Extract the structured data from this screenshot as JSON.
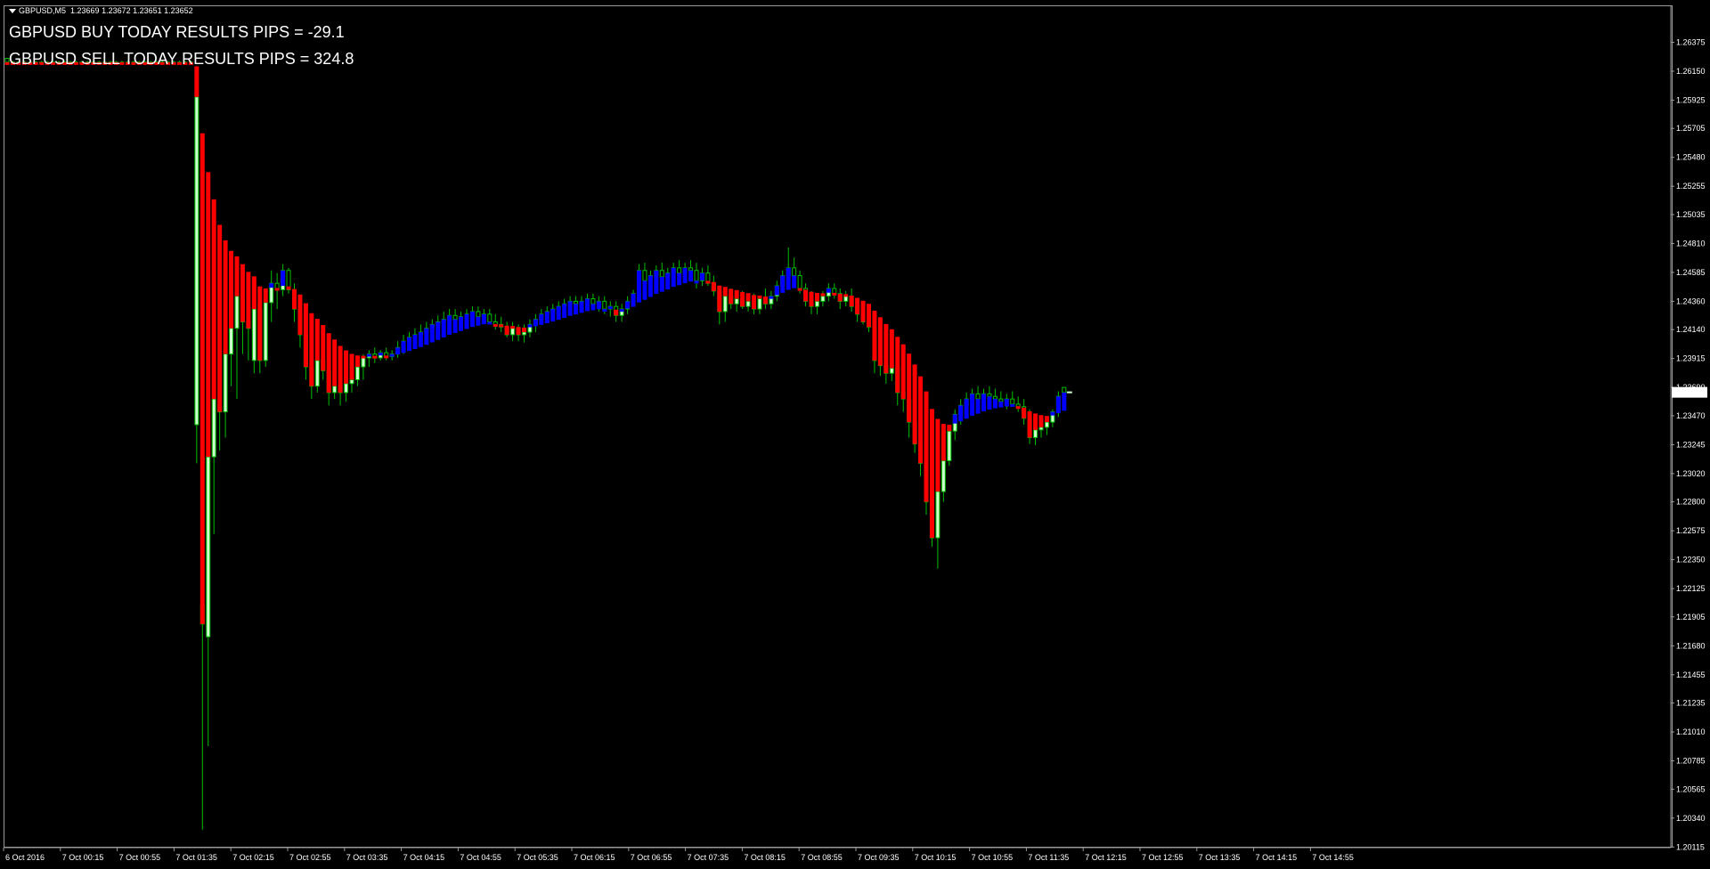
{
  "header": {
    "symbol": "GBPUSD,M5",
    "ohlc": "1.23669 1.23672 1.23651 1.23652"
  },
  "results": {
    "buy": "GBPUSD BUY TODAY RESULTS PIPS = -29.1",
    "sell": "GBPUSD SELL TODAY RESULTS PIPS = 324.8"
  },
  "current_price_label": "1.23652",
  "colors": {
    "background": "#000000",
    "frame": "#9a9a9a",
    "bull_candle": "#ccffcc",
    "bear_candle": "#000000",
    "wick": "#00c000",
    "bear_band": "#ff0000",
    "bull_band": "#0000ff"
  },
  "chart_data": {
    "type": "candlestick",
    "grid": false,
    "y_tick_labels": [
      "1.26375",
      "1.26150",
      "1.25925",
      "1.25705",
      "1.25480",
      "1.25255",
      "1.25035",
      "1.24810",
      "1.24585",
      "1.24360",
      "1.24140",
      "1.23915",
      "1.23690",
      "1.23470",
      "1.23245",
      "1.23020",
      "1.22800",
      "1.22575",
      "1.22350",
      "1.22125",
      "1.21905",
      "1.21680",
      "1.21455",
      "1.21235",
      "1.21010",
      "1.20785",
      "1.20565",
      "1.20340",
      "1.20115"
    ],
    "x_tick_labels": [
      "6 Oct 2016",
      "7 Oct 00:15",
      "7 Oct 00:55",
      "7 Oct 01:35",
      "7 Oct 02:15",
      "7 Oct 02:55",
      "7 Oct 03:35",
      "7 Oct 04:15",
      "7 Oct 04:55",
      "7 Oct 05:35",
      "7 Oct 06:15",
      "7 Oct 06:55",
      "7 Oct 07:35",
      "7 Oct 08:15",
      "7 Oct 08:55",
      "7 Oct 09:35",
      "7 Oct 10:15",
      "7 Oct 10:55",
      "7 Oct 11:35",
      "7 Oct 12:15",
      "7 Oct 12:55",
      "7 Oct 13:35",
      "7 Oct 14:15",
      "7 Oct 14:55"
    ],
    "ylim": [
      1.2011,
      1.2651
    ],
    "candle_interval_minutes": 5,
    "current_price": 1.23652,
    "candles": [
      [
        1.2625,
        1.2625,
        1.2621,
        1.2622
      ],
      [
        1.2622,
        1.2623,
        1.2621,
        1.2622
      ],
      [
        1.2622,
        1.2623,
        1.2621,
        1.2622
      ],
      [
        1.2622,
        1.2623,
        1.2621,
        1.2622
      ],
      [
        1.2622,
        1.2623,
        1.2621,
        1.2622
      ],
      [
        1.2622,
        1.2623,
        1.2621,
        1.2622
      ],
      [
        1.2622,
        1.2623,
        1.2621,
        1.2622
      ],
      [
        1.2622,
        1.2623,
        1.2621,
        1.2622
      ],
      [
        1.2622,
        1.2623,
        1.2621,
        1.2622
      ],
      [
        1.2622,
        1.2623,
        1.2621,
        1.2622
      ],
      [
        1.2622,
        1.2623,
        1.2621,
        1.2622
      ],
      [
        1.2622,
        1.2623,
        1.2621,
        1.2622
      ],
      [
        1.2622,
        1.2623,
        1.2621,
        1.2622
      ],
      [
        1.2622,
        1.2623,
        1.2621,
        1.2622
      ],
      [
        1.2622,
        1.2623,
        1.2621,
        1.2622
      ],
      [
        1.2622,
        1.2623,
        1.2621,
        1.2622
      ],
      [
        1.2622,
        1.2623,
        1.2621,
        1.2622
      ],
      [
        1.2622,
        1.2623,
        1.2621,
        1.2622
      ],
      [
        1.2622,
        1.2623,
        1.2621,
        1.2622
      ],
      [
        1.2622,
        1.2623,
        1.2621,
        1.2622
      ],
      [
        1.2622,
        1.2623,
        1.2621,
        1.2622
      ],
      [
        1.2622,
        1.2623,
        1.2621,
        1.2622
      ],
      [
        1.2622,
        1.2623,
        1.2621,
        1.2622
      ],
      [
        1.2622,
        1.2623,
        1.2621,
        1.2622
      ],
      [
        1.2622,
        1.2623,
        1.2621,
        1.2622
      ],
      [
        1.2622,
        1.2623,
        1.2621,
        1.2622
      ],
      [
        1.2622,
        1.2623,
        1.2621,
        1.2622
      ],
      [
        1.2622,
        1.2623,
        1.2621,
        1.2622
      ],
      [
        1.2622,
        1.2623,
        1.2621,
        1.2622
      ],
      [
        1.2622,
        1.2623,
        1.2621,
        1.2622
      ],
      [
        1.2622,
        1.2623,
        1.2621,
        1.2622
      ],
      [
        1.2622,
        1.2623,
        1.2621,
        1.2622
      ],
      [
        1.2622,
        1.2623,
        1.2621,
        1.2622
      ],
      [
        1.234,
        1.2605,
        1.231,
        1.2595
      ],
      [
        1.22,
        1.226,
        1.2025,
        1.2185
      ],
      [
        1.2175,
        1.2325,
        1.209,
        1.2315
      ],
      [
        1.2315,
        1.2365,
        1.2255,
        1.236
      ],
      [
        1.2355,
        1.2375,
        1.232,
        1.235
      ],
      [
        1.235,
        1.2405,
        1.233,
        1.2395
      ],
      [
        1.2395,
        1.2425,
        1.237,
        1.2415
      ],
      [
        1.2415,
        1.2445,
        1.236,
        1.244
      ],
      [
        1.244,
        1.245,
        1.2395,
        1.242
      ],
      [
        1.242,
        1.2435,
        1.239,
        1.2415
      ],
      [
        1.239,
        1.244,
        1.238,
        1.243
      ],
      [
        1.243,
        1.2445,
        1.238,
        1.239
      ],
      [
        1.239,
        1.244,
        1.2385,
        1.2435
      ],
      [
        1.2435,
        1.246,
        1.242,
        1.245
      ],
      [
        1.245,
        1.2458,
        1.243,
        1.2445
      ],
      [
        1.2445,
        1.2465,
        1.244,
        1.246
      ],
      [
        1.246,
        1.2462,
        1.2442,
        1.2445
      ],
      [
        1.2445,
        1.245,
        1.242,
        1.243
      ],
      [
        1.243,
        1.244,
        1.24,
        1.241
      ],
      [
        1.241,
        1.242,
        1.2375,
        1.2385
      ],
      [
        1.2385,
        1.2395,
        1.236,
        1.237
      ],
      [
        1.237,
        1.2395,
        1.2365,
        1.239
      ],
      [
        1.239,
        1.2395,
        1.2375,
        1.2382
      ],
      [
        1.2382,
        1.2392,
        1.2355,
        1.2365
      ],
      [
        1.2365,
        1.2385,
        1.236,
        1.237
      ],
      [
        1.237,
        1.2375,
        1.2355,
        1.2365
      ],
      [
        1.2365,
        1.2378,
        1.2358,
        1.2372
      ],
      [
        1.2372,
        1.2382,
        1.2365,
        1.2375
      ],
      [
        1.2375,
        1.239,
        1.237,
        1.2385
      ],
      [
        1.2385,
        1.2395,
        1.2375,
        1.2392
      ],
      [
        1.2392,
        1.2398,
        1.2385,
        1.2395
      ],
      [
        1.2395,
        1.24,
        1.2388,
        1.2392
      ],
      [
        1.2392,
        1.2398,
        1.239,
        1.2396
      ],
      [
        1.2396,
        1.24,
        1.239,
        1.2393
      ],
      [
        1.2393,
        1.2398,
        1.239,
        1.2395
      ],
      [
        1.2395,
        1.2405,
        1.2392,
        1.24
      ],
      [
        1.24,
        1.241,
        1.2395,
        1.2405
      ],
      [
        1.2405,
        1.2412,
        1.24,
        1.2408
      ],
      [
        1.2408,
        1.2415,
        1.2402,
        1.241
      ],
      [
        1.241,
        1.2418,
        1.2405,
        1.2412
      ],
      [
        1.2412,
        1.242,
        1.2408,
        1.2415
      ],
      [
        1.2415,
        1.2422,
        1.241,
        1.2418
      ],
      [
        1.2418,
        1.2425,
        1.2412,
        1.242
      ],
      [
        1.242,
        1.2428,
        1.2415,
        1.2422
      ],
      [
        1.2422,
        1.243,
        1.2418,
        1.2425
      ],
      [
        1.2425,
        1.243,
        1.2418,
        1.2422
      ],
      [
        1.2422,
        1.2428,
        1.2418,
        1.2424
      ],
      [
        1.2424,
        1.243,
        1.242,
        1.2426
      ],
      [
        1.2426,
        1.2432,
        1.2422,
        1.2428
      ],
      [
        1.2428,
        1.2432,
        1.2422,
        1.2424
      ],
      [
        1.2424,
        1.243,
        1.242,
        1.2426
      ],
      [
        1.2426,
        1.243,
        1.2418,
        1.242
      ],
      [
        1.242,
        1.2426,
        1.2414,
        1.2418
      ],
      [
        1.2418,
        1.2424,
        1.2412,
        1.2416
      ],
      [
        1.2416,
        1.242,
        1.2408,
        1.241
      ],
      [
        1.241,
        1.242,
        1.2405,
        1.2415
      ],
      [
        1.2415,
        1.2418,
        1.2405,
        1.241
      ],
      [
        1.241,
        1.2418,
        1.2404,
        1.2412
      ],
      [
        1.2412,
        1.2422,
        1.2408,
        1.2418
      ],
      [
        1.2418,
        1.2426,
        1.2412,
        1.2422
      ],
      [
        1.2422,
        1.243,
        1.2418,
        1.2426
      ],
      [
        1.2426,
        1.2432,
        1.242,
        1.2428
      ],
      [
        1.2428,
        1.2434,
        1.2422,
        1.243
      ],
      [
        1.243,
        1.2436,
        1.2424,
        1.2432
      ],
      [
        1.2432,
        1.2438,
        1.2426,
        1.2434
      ],
      [
        1.2434,
        1.244,
        1.2428,
        1.2436
      ],
      [
        1.2436,
        1.244,
        1.243,
        1.2434
      ],
      [
        1.2434,
        1.244,
        1.2428,
        1.2436
      ],
      [
        1.2436,
        1.2442,
        1.243,
        1.2438
      ],
      [
        1.2438,
        1.2442,
        1.243,
        1.2434
      ],
      [
        1.2434,
        1.244,
        1.2428,
        1.2436
      ],
      [
        1.2436,
        1.244,
        1.2426,
        1.243
      ],
      [
        1.243,
        1.2436,
        1.2424,
        1.2432
      ],
      [
        1.2432,
        1.2436,
        1.242,
        1.2425
      ],
      [
        1.2425,
        1.2434,
        1.242,
        1.243
      ],
      [
        1.243,
        1.244,
        1.2426,
        1.2436
      ],
      [
        1.2436,
        1.2445,
        1.2432,
        1.2442
      ],
      [
        1.2442,
        1.2465,
        1.2438,
        1.246
      ],
      [
        1.246,
        1.2466,
        1.245,
        1.2452
      ],
      [
        1.2452,
        1.246,
        1.2446,
        1.2456
      ],
      [
        1.2456,
        1.2464,
        1.245,
        1.246
      ],
      [
        1.246,
        1.2466,
        1.2452,
        1.2455
      ],
      [
        1.2455,
        1.2462,
        1.2448,
        1.2458
      ],
      [
        1.2458,
        1.2466,
        1.2452,
        1.2462
      ],
      [
        1.2462,
        1.2468,
        1.2455,
        1.2458
      ],
      [
        1.2458,
        1.2466,
        1.245,
        1.2462
      ],
      [
        1.2462,
        1.2468,
        1.2456,
        1.246
      ],
      [
        1.246,
        1.2466,
        1.2446,
        1.2452
      ],
      [
        1.2452,
        1.2462,
        1.2448,
        1.2458
      ],
      [
        1.2458,
        1.2464,
        1.2448,
        1.245
      ],
      [
        1.245,
        1.2456,
        1.244,
        1.2444
      ],
      [
        1.2444,
        1.2448,
        1.2418,
        1.2428
      ],
      [
        1.2428,
        1.2446,
        1.242,
        1.244
      ],
      [
        1.244,
        1.2446,
        1.243,
        1.2434
      ],
      [
        1.2434,
        1.2442,
        1.2428,
        1.2438
      ],
      [
        1.2438,
        1.2444,
        1.243,
        1.2432
      ],
      [
        1.2432,
        1.244,
        1.2428,
        1.2436
      ],
      [
        1.2436,
        1.2442,
        1.2426,
        1.243
      ],
      [
        1.243,
        1.244,
        1.2426,
        1.2438
      ],
      [
        1.2438,
        1.2446,
        1.243,
        1.2434
      ],
      [
        1.2434,
        1.2444,
        1.243,
        1.244
      ],
      [
        1.244,
        1.2452,
        1.2436,
        1.2448
      ],
      [
        1.2448,
        1.246,
        1.2444,
        1.2456
      ],
      [
        1.2456,
        1.2478,
        1.245,
        1.2462
      ],
      [
        1.2462,
        1.247,
        1.245,
        1.2456
      ],
      [
        1.2456,
        1.246,
        1.2442,
        1.2446
      ],
      [
        1.2446,
        1.245,
        1.2432,
        1.2436
      ],
      [
        1.2436,
        1.2444,
        1.2426,
        1.2432
      ],
      [
        1.2432,
        1.244,
        1.2426,
        1.2436
      ],
      [
        1.2436,
        1.2444,
        1.2432,
        1.244
      ],
      [
        1.244,
        1.245,
        1.2436,
        1.2446
      ],
      [
        1.2446,
        1.245,
        1.2438,
        1.2442
      ],
      [
        1.2442,
        1.2446,
        1.243,
        1.2436
      ],
      [
        1.2436,
        1.2444,
        1.2432,
        1.244
      ],
      [
        1.244,
        1.2446,
        1.2428,
        1.2432
      ],
      [
        1.2432,
        1.2436,
        1.242,
        1.2426
      ],
      [
        1.2426,
        1.2432,
        1.2418,
        1.242
      ],
      [
        1.242,
        1.2428,
        1.2412,
        1.2416
      ],
      [
        1.2416,
        1.242,
        1.238,
        1.239
      ],
      [
        1.239,
        1.2398,
        1.2378,
        1.2386
      ],
      [
        1.2386,
        1.2392,
        1.2372,
        1.238
      ],
      [
        1.238,
        1.239,
        1.2374,
        1.2384
      ],
      [
        1.2384,
        1.2388,
        1.2355,
        1.2365
      ],
      [
        1.2365,
        1.237,
        1.235,
        1.236
      ],
      [
        1.236,
        1.2364,
        1.233,
        1.2342
      ],
      [
        1.2342,
        1.235,
        1.2318,
        1.2325
      ],
      [
        1.2325,
        1.2332,
        1.23,
        1.231
      ],
      [
        1.231,
        1.2315,
        1.227,
        1.228
      ],
      [
        1.228,
        1.229,
        1.2245,
        1.2252
      ],
      [
        1.2252,
        1.23,
        1.2228,
        1.2288
      ],
      [
        1.2288,
        1.232,
        1.228,
        1.2312
      ],
      [
        1.2312,
        1.234,
        1.2308,
        1.2335
      ],
      [
        1.2335,
        1.2352,
        1.2328,
        1.2348
      ],
      [
        1.2348,
        1.236,
        1.234,
        1.2355
      ],
      [
        1.2355,
        1.2365,
        1.2348,
        1.236
      ],
      [
        1.236,
        1.2368,
        1.235,
        1.2364
      ],
      [
        1.2364,
        1.237,
        1.2354,
        1.236
      ],
      [
        1.236,
        1.2368,
        1.2354,
        1.2364
      ],
      [
        1.2364,
        1.237,
        1.2358,
        1.2362
      ],
      [
        1.2362,
        1.2368,
        1.2356,
        1.236
      ],
      [
        1.236,
        1.2366,
        1.2354,
        1.2358
      ],
      [
        1.2358,
        1.2364,
        1.2352,
        1.236
      ],
      [
        1.236,
        1.2366,
        1.2354,
        1.2356
      ],
      [
        1.2356,
        1.2362,
        1.235,
        1.2354
      ],
      [
        1.2354,
        1.236,
        1.234,
        1.2345
      ],
      [
        1.2345,
        1.2352,
        1.2325,
        1.233
      ],
      [
        1.233,
        1.234,
        1.2324,
        1.2336
      ],
      [
        1.2336,
        1.2342,
        1.233,
        1.2338
      ],
      [
        1.2338,
        1.2346,
        1.2332,
        1.2342
      ],
      [
        1.2342,
        1.2352,
        1.2338,
        1.235
      ],
      [
        1.235,
        1.2366,
        1.2346,
        1.2362
      ],
      [
        1.2369,
        1.2367,
        1.2365,
        1.2365
      ]
    ],
    "band_series": [
      {
        "color": "bear",
        "pairs": [
          [
            1.2622,
            1.2626
          ],
          [
            1.2622,
            1.2626
          ],
          [
            1.2622,
            1.2626
          ],
          [
            1.2622,
            1.2626
          ],
          [
            1.2622,
            1.2626
          ],
          [
            1.2622,
            1.2626
          ],
          [
            1.2622,
            1.2626
          ],
          [
            1.2622,
            1.2626
          ],
          [
            1.2622,
            1.2626
          ],
          [
            1.2622,
            1.2626
          ],
          [
            1.2622,
            1.2626
          ],
          [
            1.2622,
            1.2626
          ],
          [
            1.2622,
            1.2626
          ],
          [
            1.2622,
            1.2626
          ],
          [
            1.2622,
            1.2626
          ],
          [
            1.2622,
            1.2626
          ],
          [
            1.2622,
            1.2626
          ],
          [
            1.2622,
            1.2626
          ],
          [
            1.2622,
            1.2626
          ],
          [
            1.2622,
            1.2626
          ],
          [
            1.2622,
            1.2626
          ],
          [
            1.2622,
            1.2626
          ],
          [
            1.2622,
            1.2626
          ],
          [
            1.2622,
            1.2626
          ],
          [
            1.2622,
            1.2626
          ],
          [
            1.2622,
            1.2626
          ],
          [
            1.2622,
            1.2626
          ],
          [
            1.2622,
            1.2626
          ],
          [
            1.2622,
            1.2626
          ],
          [
            1.2622,
            1.2626
          ],
          [
            1.2622,
            1.2626
          ],
          [
            1.2622,
            1.2626
          ],
          [
            1.2622,
            1.2626
          ]
        ]
      }
    ]
  }
}
